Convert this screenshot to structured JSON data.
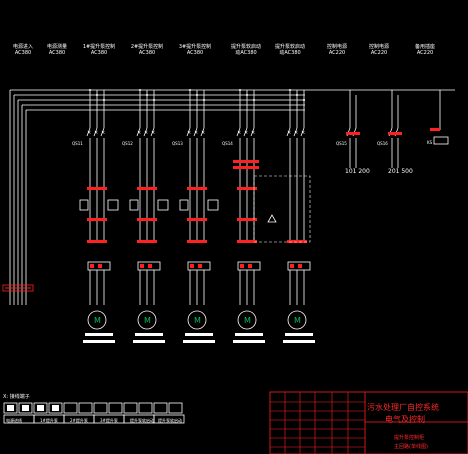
{
  "headers": [
    {
      "line1": "电源进入",
      "line2": "AC380"
    },
    {
      "line1": "电源测量",
      "line2": "AC380"
    },
    {
      "line1": "1#提升泵控制",
      "line2": "AC380"
    },
    {
      "line1": "2#提升泵控制",
      "line2": "AC380"
    },
    {
      "line1": "3#提升泵控制",
      "line2": "AC380"
    },
    {
      "line1": "提升泵软启动",
      "line2": "动AC380"
    },
    {
      "line1": "提升泵软启动",
      "line2": "动AC380"
    },
    {
      "line1": "控制电源",
      "line2": "AC220"
    },
    {
      "line1": "控制电源",
      "line2": "AC220"
    },
    {
      "line1": "备用插座",
      "line2": "AC220"
    }
  ],
  "breaker_labels": [
    "QS11",
    "QS12",
    "QS13",
    "QS14",
    "QS15",
    "QS16"
  ],
  "control_breaker_label": "KS",
  "wire_numbers": [
    "101 200",
    "201 500"
  ],
  "terminal_block": {
    "title": "X: 接线端子",
    "labels": [
      "电源进线",
      "1#提升泵",
      "2#提升泵",
      "3#提升泵",
      "提升泵软启动",
      "提升泵软启动"
    ]
  },
  "title_block": {
    "project": "污水处理厂自控系统",
    "subtitle": "电气及控制",
    "drawing_line1": "提升泵控制柜",
    "drawing_line2": "主回路(单线图)"
  },
  "colors": {
    "wire": "#ffffff",
    "accent": "#ff2020",
    "motor": "#00c060"
  }
}
